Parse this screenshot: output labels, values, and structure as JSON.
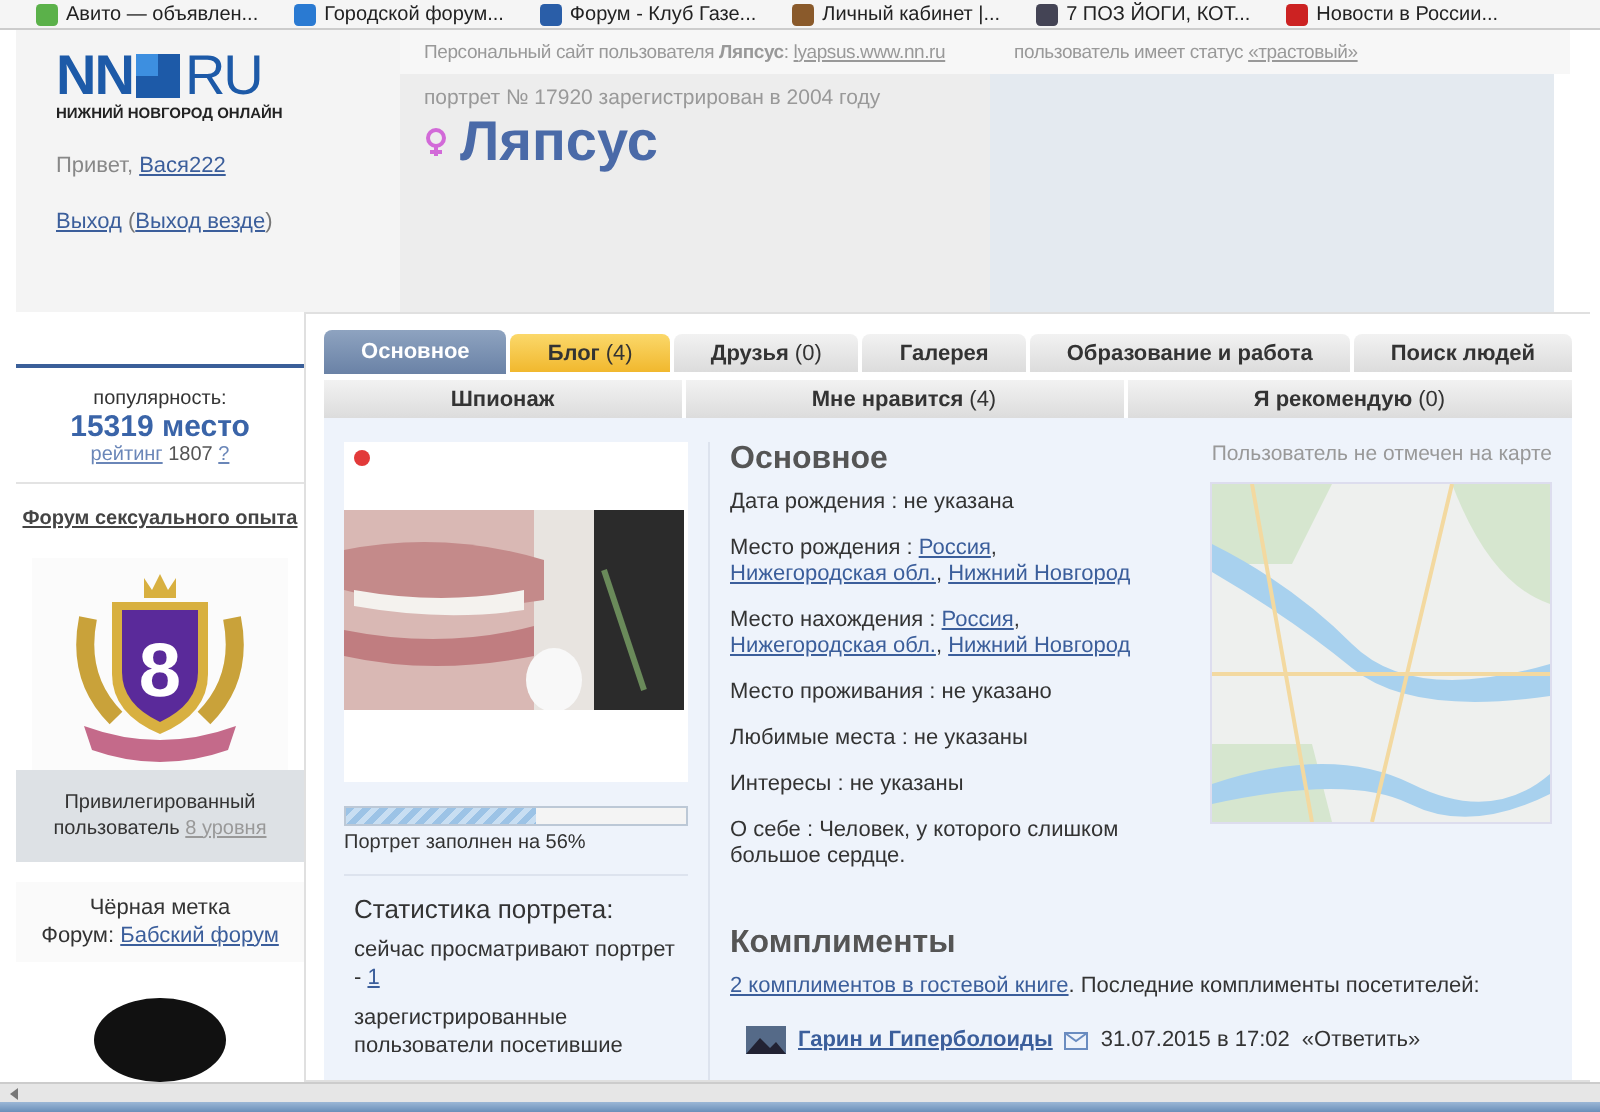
{
  "bookmarks": [
    {
      "label": "Авито — объявлен..."
    },
    {
      "label": "Городской форум..."
    },
    {
      "label": "Форум - Клуб Газе..."
    },
    {
      "label": "Личный кабинет |..."
    },
    {
      "label": "7 ПОЗ ЙОГИ, КОТ..."
    },
    {
      "label": "Новости в России..."
    }
  ],
  "header": {
    "logo": {
      "main": "NN",
      "suffix": "RU",
      "tagline": "НИЖНИЙ НОВГОРОД ОНЛАЙН"
    },
    "greeting": "Привет,",
    "username": "Вася222",
    "logout": "Выход",
    "logout_open": "(",
    "logout_all": "Выход везде",
    "logout_close": ")",
    "site_line": "Персональный сайт пользователя **Ляпсус**:",
    "site_url": "lyapsus.www.nn.ru",
    "status_text": "пользователь имеет статус",
    "status_link": "«трастовый»",
    "registered": "портрет № 17920 зарегистрирован в 2004 году",
    "profile_name": "Ляпсус"
  },
  "sidebar": {
    "popularity_label": "популярность:",
    "place": "15319 место",
    "rating_link": "рейтинг",
    "rating": "1807",
    "rating_help": "?",
    "forum_link": "Форум сексуального опыта",
    "badge_number": "8",
    "badge_caption": "Привилегированный пользователь",
    "badge_level": "8 уровня",
    "mark_title": "Чёрная метка",
    "mark_forum_label": "Форум:",
    "mark_forum": "Бабский форум"
  },
  "tab_rows": [
    {
      "tabs": [
        {
          "label": "Основное",
          "selected": true,
          "highlighted": false
        },
        {
          "label": "Блог",
          "count": "(4)",
          "selected": false,
          "highlighted": true
        },
        {
          "label": "Друзья",
          "count": "(0)",
          "selected": false,
          "highlighted": false
        },
        {
          "label": "Галерея",
          "selected": false,
          "highlighted": false
        },
        {
          "label": "Образование и работа",
          "selected": false,
          "highlighted": false
        },
        {
          "label": "Поиск людей",
          "selected": false,
          "highlighted": false
        }
      ]
    },
    {
      "tabs": [
        {
          "label": "Шпионаж",
          "selected": false,
          "highlighted": false
        },
        {
          "label": "Мне нравится",
          "count": "(4)",
          "selected": false,
          "highlighted": false
        },
        {
          "label": "Я рекомендую",
          "count": "(0)",
          "selected": false,
          "highlighted": false
        }
      ]
    }
  ],
  "profile": {
    "online": true,
    "fill": {
      "level": 0.56,
      "caption": "Портрет заполнен на 56%"
    },
    "stats": {
      "title": "Статистика портрета:",
      "viewing": "сейчас просматривают портрет -",
      "viewing_count": "1",
      "registered_visitors": "зарегистрированные пользователи посетившие"
    },
    "section_title": "Основное",
    "map_caption": "Пользователь не отмечен на карте",
    "fields": [
      {
        "label": "Дата рождения :",
        "value": "не указана"
      },
      {
        "label": "Место рождения :",
        "parts": [
          {
            "link": "Россия",
            "after": ","
          },
          {
            "link": "Нижегородская обл.",
            "after": ","
          },
          {
            "link": "Нижний Новгород"
          }
        ]
      },
      {
        "label": "Место нахождения :",
        "parts": [
          {
            "link": "Россия",
            "after": ","
          },
          {
            "link": "Нижегородская обл.",
            "after": ","
          },
          {
            "link": "Нижний Новгород"
          }
        ]
      },
      {
        "label": "Место проживания :",
        "value": "не указано"
      },
      {
        "label": "Любимые места :",
        "value": "не указаны"
      },
      {
        "label": "Интересы :",
        "value": "не указаны"
      },
      {
        "label": "О себе :",
        "value": "Человек, у которого слишком большое сердце."
      }
    ]
  },
  "compliments": {
    "title": "Комплименты",
    "guestbook_link": "2 комплиментов в гостевой книге",
    "summary": ". Последние комплименты посетителей:",
    "entries": [
      {
        "author": "Гарин и Гиперболоиды",
        "date": "31.07.2015 в 17:02",
        "reply": "«Ответить»"
      }
    ]
  }
}
